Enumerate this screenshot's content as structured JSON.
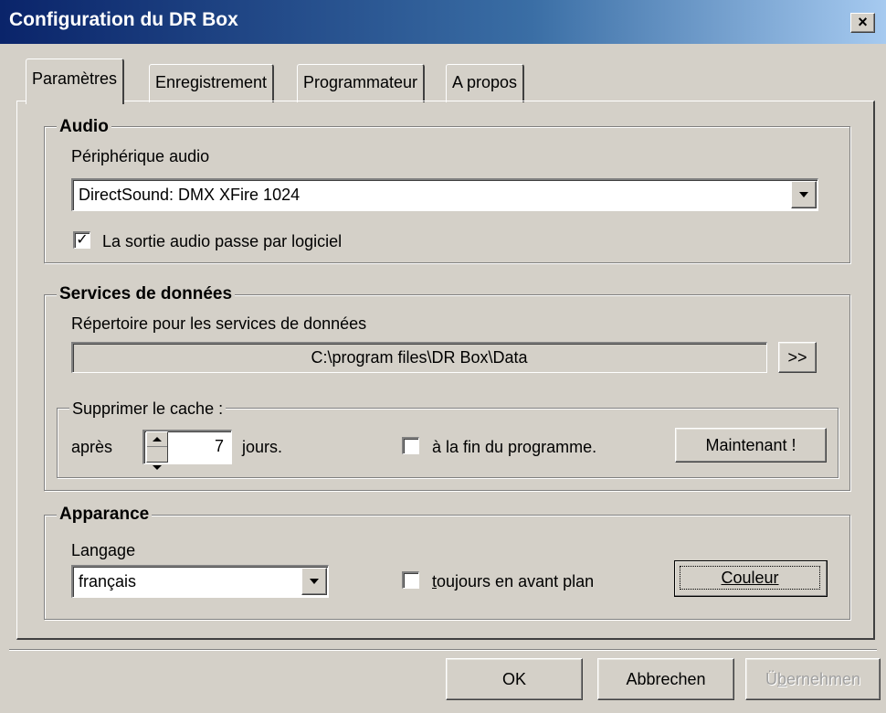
{
  "window": {
    "title": "Configuration du DR Box",
    "close_label": "×"
  },
  "tabs": [
    {
      "label": "Paramètres",
      "active": true
    },
    {
      "label": "Enregistrement",
      "active": false
    },
    {
      "label": "Programmateur",
      "active": false
    },
    {
      "label": "A propos",
      "active": false
    }
  ],
  "audio": {
    "group_label": "Audio",
    "device_label": "Périphérique audio",
    "device_value": "DirectSound: DMX XFire 1024",
    "software_output_label": "La sortie audio passe par logiciel",
    "software_output_checked": true
  },
  "data_services": {
    "group_label": "Services de données",
    "directory_label": "Répertoire pour les services de données",
    "directory_value": "C:\\program files\\DR Box\\Data",
    "browse_label": ">>",
    "cache": {
      "group_label": "Supprimer le cache :",
      "after_label": "après",
      "days_value": "7",
      "days_label": "jours.",
      "at_end_label": "à la fin du programme.",
      "at_end_checked": false,
      "now_label": "Maintenant !"
    }
  },
  "appearance": {
    "group_label": "Apparance",
    "language_label": "Langage",
    "language_value": "français",
    "always_on_top_prefix": "t",
    "always_on_top_rest": "oujours en avant plan",
    "always_on_top_checked": false,
    "color_label": "Couleur"
  },
  "footer": {
    "ok_label": "OK",
    "cancel_label": "Abbrechen",
    "apply_prefix": "Ü",
    "apply_accel": "b",
    "apply_rest": "ernehmen"
  }
}
